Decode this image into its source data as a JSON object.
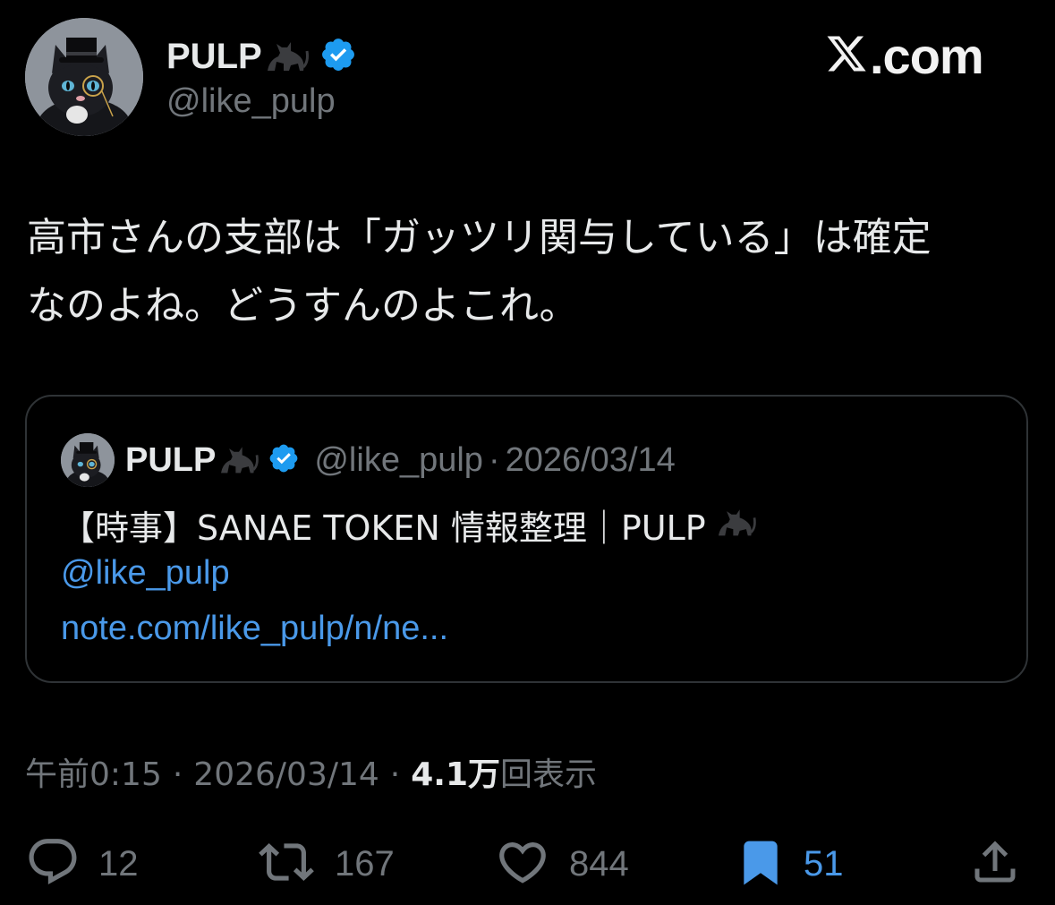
{
  "author": {
    "display_name": "PULP",
    "emoji": "cat-emoji",
    "handle": "@like_pulp",
    "verified_icon": "verified-badge-icon"
  },
  "brand": {
    "logo_icon": "x-logo-icon",
    "text": ".com"
  },
  "tweet": {
    "text": "高市さんの支部は「ガッツリ関与している」は確定\nなのよね。どうすんのよこれ。"
  },
  "quote": {
    "display_name": "PULP",
    "handle": "@like_pulp",
    "dot": "·",
    "date": "2026/03/14",
    "title": "【時事】SANAE TOKEN 情報整理｜PULP",
    "mention": "@like_pulp",
    "link": "note.com/like_pulp/n/ne..."
  },
  "meta": {
    "time": "午前0:15",
    "sep1": "·",
    "date": "2026/03/14",
    "sep2": "·",
    "views_count": "4.1万",
    "views_label": "回表示"
  },
  "actions": {
    "replies": "12",
    "reposts": "167",
    "likes": "844",
    "bookmarks": "51"
  },
  "colors": {
    "background": "#000000",
    "text": "#e7e9ea",
    "muted": "#71767b",
    "accent": "#4a99e9",
    "border": "#2f3336"
  }
}
